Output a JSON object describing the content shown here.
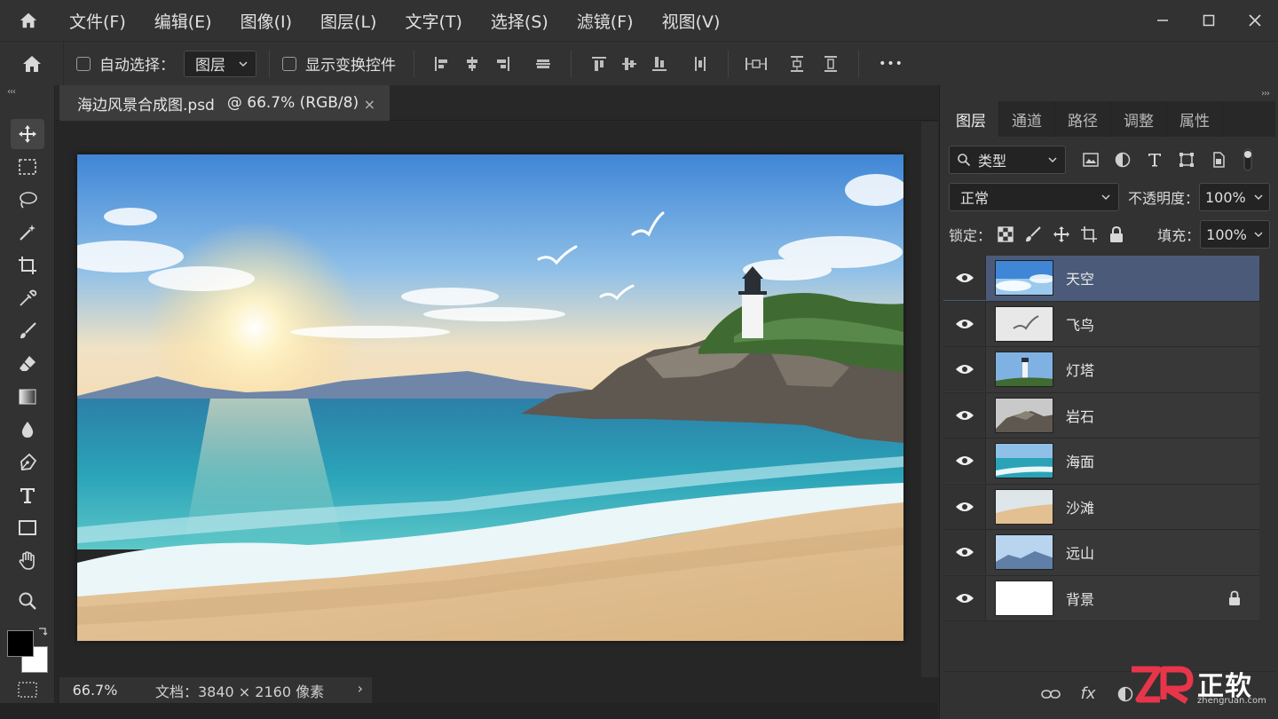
{
  "menubar": {
    "items": [
      "文件(F)",
      "编辑(E)",
      "图像(I)",
      "图层(L)",
      "文字(T)",
      "选择(S)",
      "滤镜(F)",
      "视图(V)"
    ]
  },
  "options": {
    "auto_select_label": "自动选择：",
    "auto_select_target": "图层",
    "show_transform_label": "显示变换控件",
    "more_label": "•••"
  },
  "toolbar": {
    "collapse": "‹‹‹",
    "tools": [
      "move-tool",
      "marquee-tool",
      "lasso-tool",
      "magic-wand-tool",
      "crop-tool",
      "eyedropper-tool",
      "brush-tool",
      "eraser-tool",
      "gradient-tool",
      "blur-tool",
      "pen-tool",
      "type-tool",
      "rectangle-tool",
      "hand-tool",
      "zoom-tool"
    ],
    "foreground_color": "#000000",
    "background_color": "#ffffff"
  },
  "document": {
    "filename": "海边风景合成图.psd",
    "zoom_info": "@ 66.7% (RGB/8)",
    "close": "×"
  },
  "status": {
    "zoom": "66.7%",
    "doc_info": "文档：3840 × 2160 像素",
    "arrow": "›"
  },
  "panel": {
    "collapse": "›››",
    "tabs": [
      "图层",
      "通道",
      "路径",
      "调整",
      "属性"
    ],
    "filter_kind": "类型",
    "blend_mode": "正常",
    "opacity_label": "不透明度：",
    "opacity_value": "100%",
    "lock_label": "锁定：",
    "fill_label": "填充：",
    "fill_value": "100%",
    "layers": [
      {
        "name": "天空",
        "selected": true,
        "locked": false
      },
      {
        "name": "飞鸟",
        "selected": false,
        "locked": false
      },
      {
        "name": "灯塔",
        "selected": false,
        "locked": false
      },
      {
        "name": "岩石",
        "selected": false,
        "locked": false
      },
      {
        "name": "海面",
        "selected": false,
        "locked": false
      },
      {
        "name": "沙滩",
        "selected": false,
        "locked": false
      },
      {
        "name": "远山",
        "selected": false,
        "locked": false
      },
      {
        "name": "背景",
        "selected": false,
        "locked": true
      }
    ],
    "footer_fx": "fx"
  },
  "watermark": {
    "text": "ZR正软",
    "url": "zhengruan.com"
  },
  "colors": {
    "accent_selected": "#4a5a78",
    "panel_bg": "#323232",
    "canvas_bg": "#262626"
  }
}
